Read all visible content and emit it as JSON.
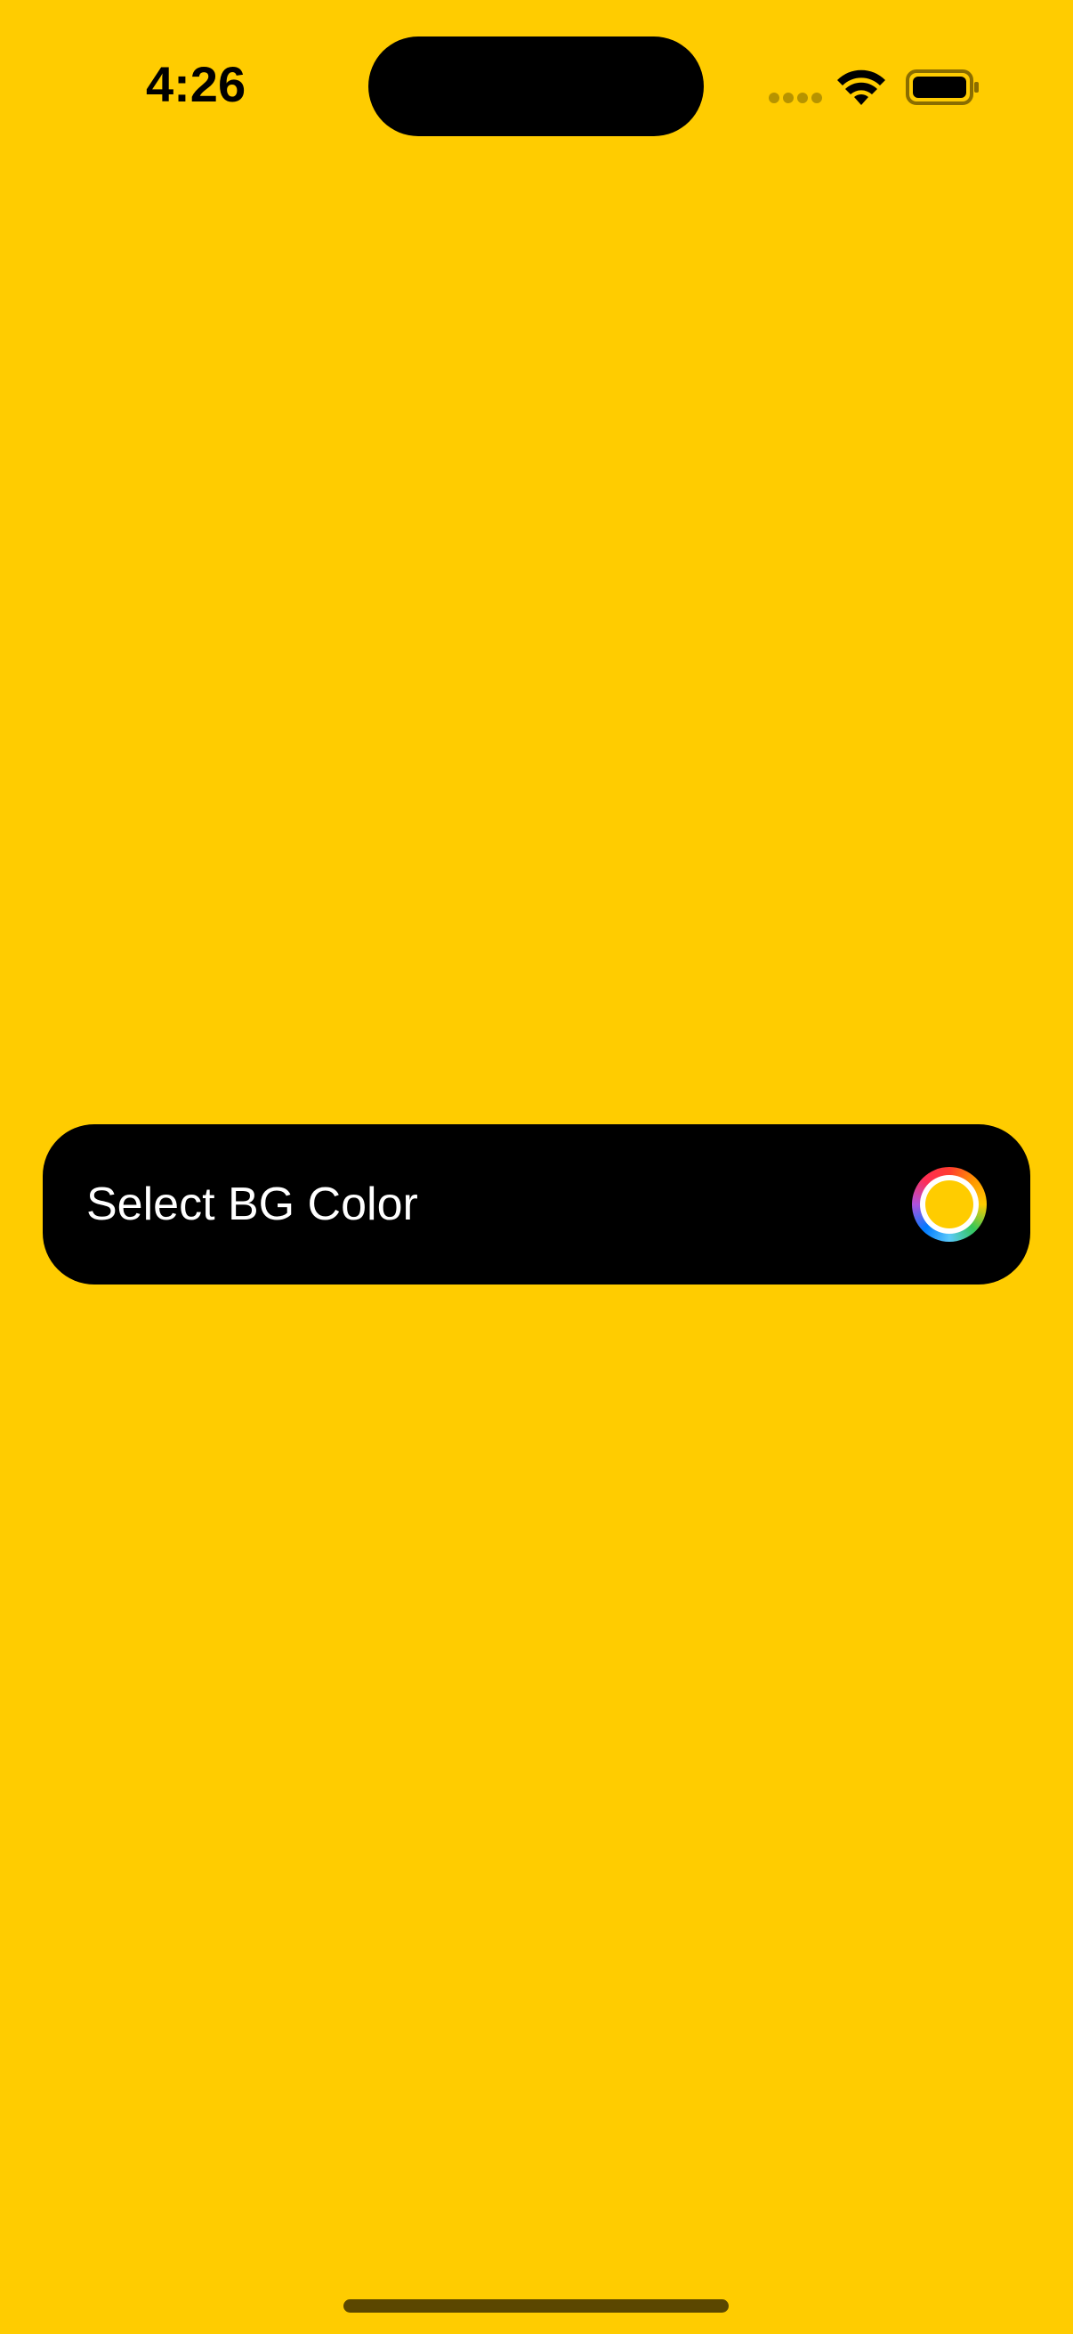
{
  "status_bar": {
    "time": "4:26",
    "icons": [
      "cellular-signal-icon",
      "wifi-icon",
      "battery-icon"
    ]
  },
  "colors": {
    "background": "#FFCC00",
    "row_background": "#000000",
    "row_text": "#FFFFFF",
    "selected_color": "#FFCC00"
  },
  "settings_row": {
    "label": "Select BG Color",
    "control": "color-picker-well"
  }
}
